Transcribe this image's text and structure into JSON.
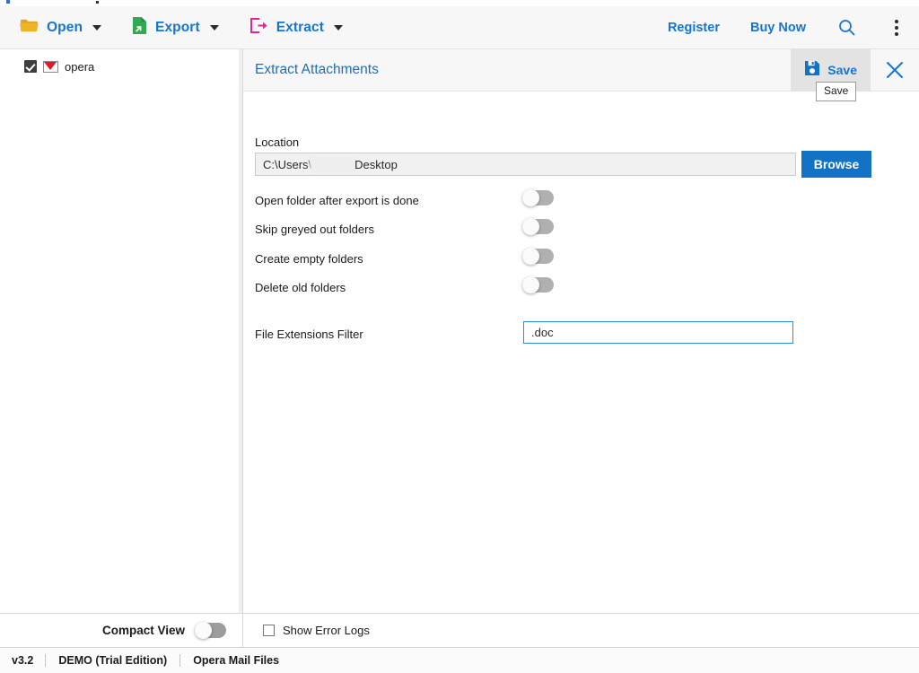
{
  "app": {
    "title": "Opera Mail Files"
  },
  "toolbar": {
    "items": [
      {
        "label": "Open",
        "icon": "folder-icon",
        "has_caret": true
      },
      {
        "label": "Export",
        "icon": "export-file-icon",
        "has_caret": true
      },
      {
        "label": "Extract",
        "icon": "extract-arrow-icon",
        "has_caret": true
      }
    ],
    "links": [
      {
        "label": "Register"
      },
      {
        "label": "Buy Now"
      }
    ],
    "search_icon": "search-icon",
    "menu_icon": "kebab-menu-icon",
    "accent_color": "#1675d1"
  },
  "sidebar": {
    "items": [
      {
        "label": "opera",
        "checked": true,
        "icon": "mail-envelope-icon"
      }
    ],
    "compact_view": {
      "label": "Compact View",
      "state": "off"
    }
  },
  "panel": {
    "title": "Extract Attachments",
    "save_button": {
      "label": "Save",
      "icon": "floppy-disk-icon",
      "tooltip": "Save",
      "hovered": true
    },
    "close_button": {
      "icon": "close-x-icon"
    }
  },
  "form": {
    "location": {
      "label": "Location",
      "value_prefix": "C:\\Users\\",
      "value_suffix": "Desktop",
      "redacted": true
    },
    "browse_button": {
      "label": "Browse",
      "color": "#1472c4"
    },
    "toggles": [
      {
        "label": "Open folder after export is done",
        "state": "off"
      },
      {
        "label": "Skip greyed out folders",
        "state": "off"
      },
      {
        "label": "Create empty folders",
        "state": "off"
      },
      {
        "label": "Delete old folders",
        "state": "off"
      }
    ],
    "extensions_filter": {
      "label": "File Extensions Filter",
      "value": ".doc",
      "focused": true
    }
  },
  "footer": {
    "show_error_logs": {
      "label": "Show Error Logs",
      "checked": false
    }
  },
  "statusbar": {
    "version": "v3.2",
    "edition": "DEMO (Trial Edition)",
    "file_type": "Opera Mail Files"
  }
}
